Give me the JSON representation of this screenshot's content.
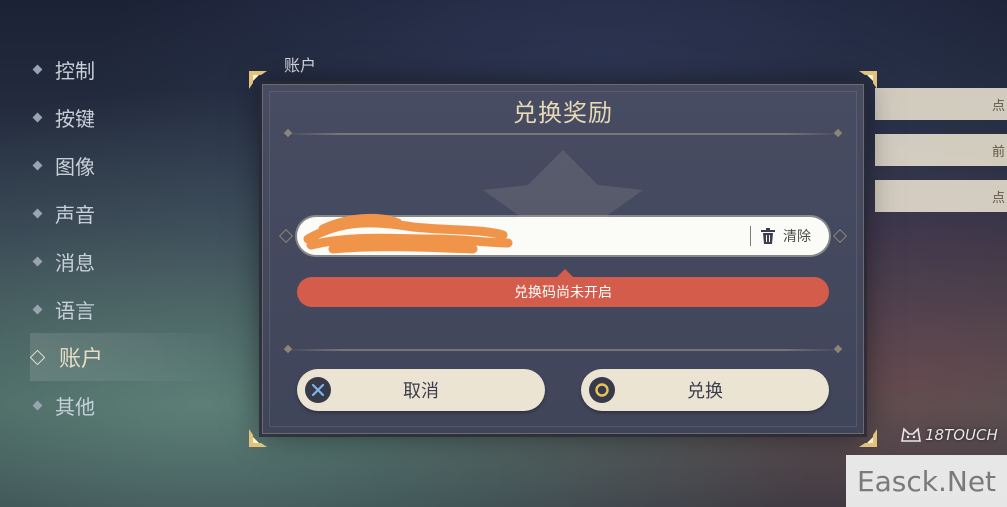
{
  "menu": {
    "items": [
      {
        "label": "控制",
        "active": false
      },
      {
        "label": "按键",
        "active": false
      },
      {
        "label": "图像",
        "active": false
      },
      {
        "label": "声音",
        "active": false
      },
      {
        "label": "消息",
        "active": false
      },
      {
        "label": "语言",
        "active": false
      },
      {
        "label": "账户",
        "active": true
      },
      {
        "label": "其他",
        "active": false
      }
    ]
  },
  "section": {
    "title": "账户"
  },
  "background_rows": [
    {
      "label": "点"
    },
    {
      "label": "前"
    },
    {
      "label": "点"
    }
  ],
  "dialog": {
    "title": "兑换奖励",
    "input": {
      "value": "",
      "value_redacted": true
    },
    "clear_label": "清除",
    "error": "兑换码尚未开启",
    "cancel_label": "取消",
    "confirm_label": "兑换"
  },
  "watermarks": {
    "touch": "18TOUCH",
    "easck": "Easck.Net"
  },
  "icons": {
    "cancel": "cross-button-icon",
    "confirm": "circle-button-icon",
    "clear": "trash-icon"
  },
  "colors": {
    "error": "#d45c4a",
    "title_gold": "#e8d9b6",
    "button_bg": "#ece4d3",
    "dialog_bg": "#444a5f"
  }
}
